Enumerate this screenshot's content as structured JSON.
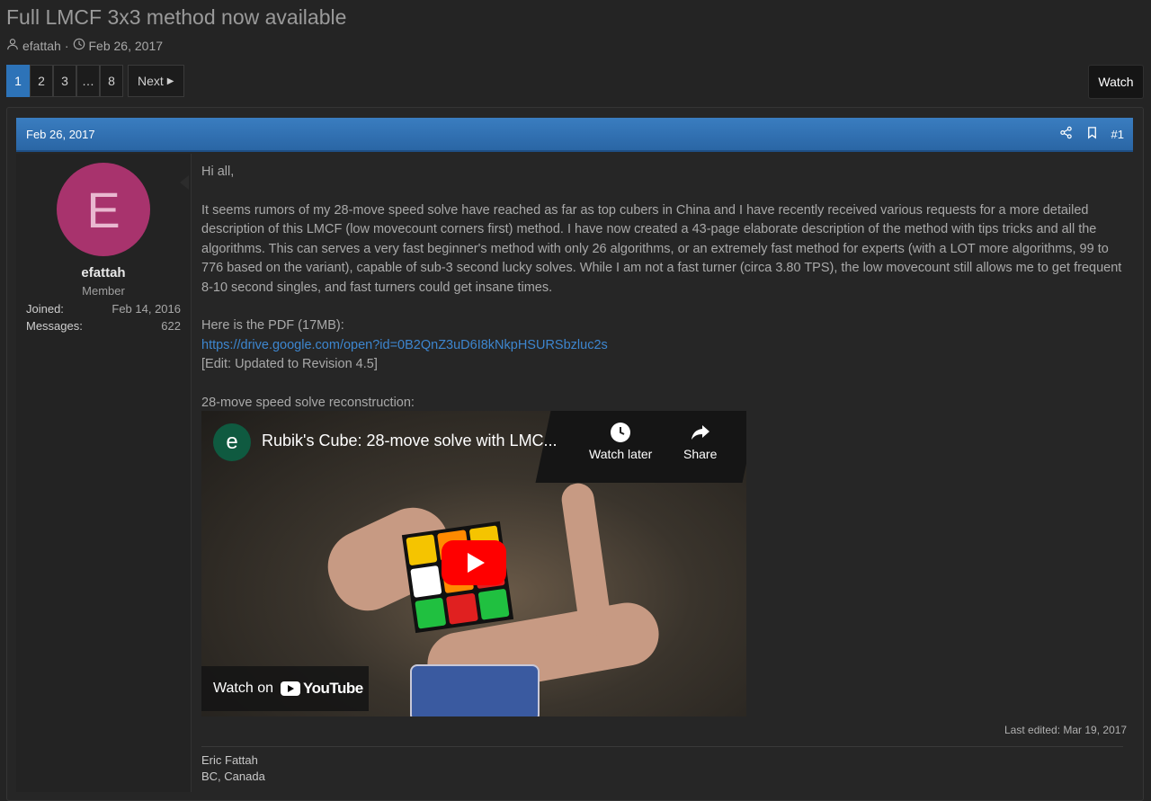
{
  "thread": {
    "title": "Full LMCF 3x3 method now available",
    "author": "efattah",
    "date": "Feb 26, 2017"
  },
  "pagination": {
    "pages": [
      "1",
      "2",
      "3",
      "…",
      "8"
    ],
    "active_page": "1",
    "next_label": "Next"
  },
  "watch_button": "Watch",
  "post": {
    "date": "Feb 26, 2017",
    "number": "#1",
    "user": {
      "avatar_letter": "E",
      "avatar_color": "#a8336d",
      "name": "efattah",
      "role": "Member",
      "joined_label": "Joined:",
      "joined_value": "Feb 14, 2016",
      "messages_label": "Messages:",
      "messages_value": "622"
    },
    "greeting": "Hi all,",
    "body": "It seems rumors of my 28-move speed solve have reached as far as top cubers in China and I have recently received various requests for a more detailed description of this LMCF (low movecount corners first) method. I have now created a 43-page elaborate description of the method with tips tricks and all the algorithms. This can serves a very fast beginner's method with only 26 algorithms, or an extremely fast method for experts (with a LOT more algorithms, 99 to 776 based on the variant), capable of sub-3 second lucky solves. While I am not a fast turner (circa 3.80 TPS), the low movecount still allows me to get frequent 8-10 second singles, and fast turners could get insane times.",
    "pdf_label": "Here is the PDF (17MB):",
    "pdf_link": "https://drive.google.com/open?id=0B2QnZ3uD6I8kNkpHSURSbzluc2s",
    "edit_note": "[Edit: Updated to Revision 4.5]",
    "video_label": "28-move speed solve reconstruction:",
    "video": {
      "channel_letter": "e",
      "title": "Rubik's Cube: 28-move solve with LMC...",
      "watch_later": "Watch later",
      "share": "Share",
      "watch_on": "Watch on",
      "youtube": "YouTube"
    },
    "last_edited": "Last edited: Mar 19, 2017",
    "signature": [
      "Eric Fattah",
      "BC, Canada"
    ]
  },
  "colors": {
    "accent": "#2d73b8",
    "header_gradient_top": "#3a7dc0",
    "link": "#3d86cf",
    "youtube_red": "#ff0000"
  }
}
